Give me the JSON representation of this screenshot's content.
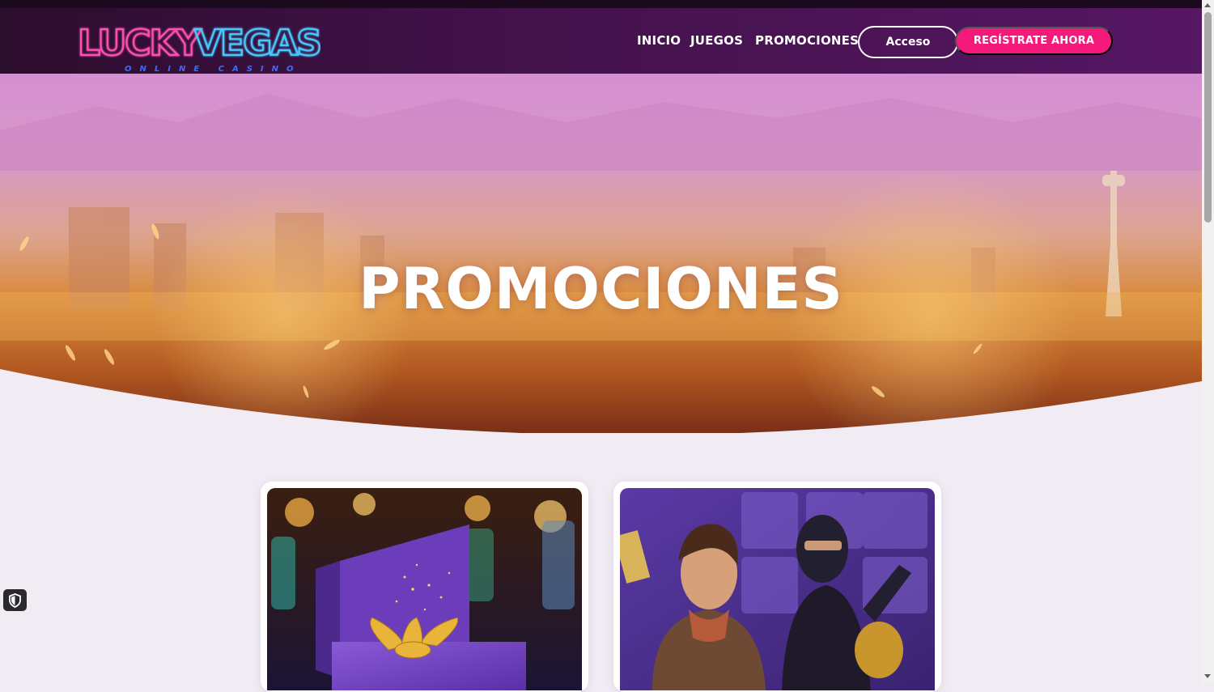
{
  "brand": {
    "logo_text_pink": "LUCKY",
    "logo_text_blue": "VEGAS",
    "logo_tagline": "ONLINE CASINO"
  },
  "nav": {
    "items": [
      {
        "label": "INICIO"
      },
      {
        "label": "JUEGOS"
      },
      {
        "label": "PROMOCIONES"
      }
    ],
    "login_label": "Acceso",
    "register_label": "REGÍSTRATE AHORA"
  },
  "hero": {
    "title": "PROMOCIONES"
  },
  "colors": {
    "accent_pink": "#f5197b",
    "header_purple": "#3f1146",
    "page_bg": "#f1ecf4",
    "neon_blue": "#3ec4ff",
    "neon_pink": "#ff3fa0"
  },
  "icons": {
    "privacy": "shield-icon",
    "promo_gift": "gift-box-icon"
  }
}
